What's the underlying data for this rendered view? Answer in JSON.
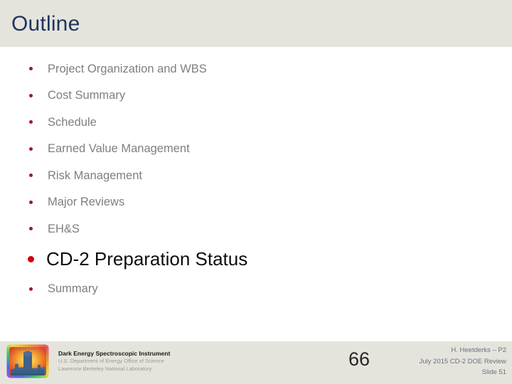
{
  "header": {
    "title": "Outline",
    "band_color": "#e5e4dc",
    "title_color": "#1f3560"
  },
  "outline": {
    "bullet_color": "#9c1b27",
    "emphasis_bullet_color": "#d00000",
    "text_color": "#7f7f7f",
    "emphasis_text_color": "#0d0d0d",
    "items": [
      {
        "label": "Project Organization and WBS",
        "emphasis": false
      },
      {
        "label": "Cost Summary",
        "emphasis": false
      },
      {
        "label": "Schedule",
        "emphasis": false
      },
      {
        "label": "Earned Value Management",
        "emphasis": false
      },
      {
        "label": "Risk Management",
        "emphasis": false
      },
      {
        "label": "Major Reviews",
        "emphasis": false
      },
      {
        "label": "EH&S",
        "emphasis": false
      },
      {
        "label": "CD-2 Preparation Status",
        "emphasis": true
      },
      {
        "label": "Summary",
        "emphasis": false
      }
    ]
  },
  "footer": {
    "band_color": "#e5e4dc",
    "logo_icon": "desi-observatory-logo-icon",
    "logo_caption": "ENERGY",
    "organization": "Dark Energy Spectroscopic Instrument",
    "sponsor": "U.S. Department of Energy Office of Science",
    "laboratory": "Lawrence Berkeley National Laboratory",
    "page_number": "66",
    "presenter": "H. Heetderks – P2",
    "event": "July 2015 CD-2 DOE Review",
    "slide_label": "Slide 51"
  }
}
